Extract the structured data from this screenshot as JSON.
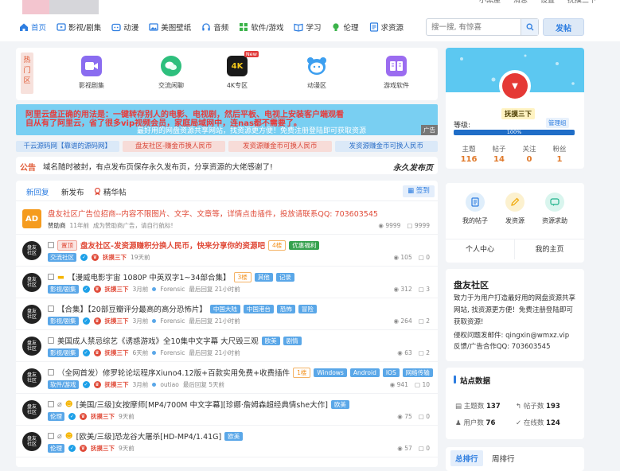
{
  "header": {
    "top_links": [
      "小黑屋",
      "消息",
      "设置",
      "抚摸三下"
    ],
    "nav": [
      {
        "label": "首页",
        "icon": "home-icon",
        "active": true
      },
      {
        "label": "影视/剧集",
        "icon": "video-icon"
      },
      {
        "label": "动漫",
        "icon": "anime-icon"
      },
      {
        "label": "美图壁纸",
        "icon": "image-icon"
      },
      {
        "label": "音频",
        "icon": "headphones-icon"
      },
      {
        "label": "软件/游戏",
        "icon": "apps-icon"
      },
      {
        "label": "学习",
        "icon": "book-icon"
      },
      {
        "label": "伦理",
        "icon": "bulb-icon"
      },
      {
        "label": "求资源",
        "icon": "request-icon"
      }
    ],
    "search_placeholder": "搜一搜, 有惊喜",
    "post_label": "发帖"
  },
  "quick": {
    "label": "热门区",
    "items": [
      {
        "label": "影视剧集",
        "icon": "video-cam-icon",
        "color": "#8a6cf0"
      },
      {
        "label": "交流闲聊",
        "icon": "chat-icon",
        "color": "#2ebf7d"
      },
      {
        "label": "4K专区",
        "icon": "4k-icon",
        "badge": "New"
      },
      {
        "label": "动漫区",
        "icon": "bear-icon",
        "color": "#3d9ff0"
      },
      {
        "label": "游戏软件",
        "icon": "book-app-icon",
        "color": "#9b6cf0"
      }
    ]
  },
  "banner": {
    "line1": "阿里云盘正确的用法是：一键转存别人的电影、电视剧，然后平板、电视上安装客户端观看",
    "line2": "自从有了阿里云，省了很多vip视频会员，家庭局域网中，连nas都不需要了。",
    "line3": "最好用的网盘资源共享网站，找资源更方便！免费注册登陆即可获取资源",
    "ad_label": "广告"
  },
  "links": [
    "千云源码网【靠谱的源码网】",
    "盘友社区-赚金币换人民币",
    "发资源赚金币可换人民币",
    "发资源赚金币可换人民币"
  ],
  "announce": {
    "label": "公告",
    "text": "域名随时被封，有点发布页保存永久发布页，分享资源的大佬感谢了!",
    "right": "永久发布页"
  },
  "thread_tabs": {
    "tabs": [
      "新回复",
      "新发布",
      "精华帖"
    ],
    "checkin": "签到"
  },
  "threads": [
    {
      "title": "盘友社区广告位招商--内容不限图片、文字、文章等，详情点击插件，投放请联系QQ: 703603545",
      "author": "赞助商",
      "time": "11年前",
      "extra": "成为赞助商广告，请自行航标!",
      "views": "9999",
      "replies": "9999",
      "avatar": "AD",
      "style": "ad"
    },
    {
      "title": "盘友社区-发资源赚积分换人民币，快来分享你的资源吧",
      "prefix": "置顶",
      "cat": "交流社区",
      "tags": [
        {
          "t": "4楼",
          "c": "orange"
        },
        {
          "t": "优惠福利",
          "c": "green"
        }
      ],
      "author": "抚摸三下",
      "time": "19天前",
      "views": "105",
      "replies": "0"
    },
    {
      "title": "【漫威电影宇宙 1080P 中英双字1~34部合集】",
      "cat": "影视/剧集",
      "tags": [
        {
          "t": "3楼",
          "c": "orange"
        },
        {
          "t": "其他",
          "c": "blue"
        },
        {
          "t": "记录",
          "c": "blue"
        }
      ],
      "author": "抚摸三下",
      "time": "3月前",
      "last": "Forensic",
      "last_time": "最后回复 21小时前",
      "views": "312",
      "replies": "3"
    },
    {
      "title": "【合集】【20部豆瓣评分最高的高分恐怖片】",
      "cat": "影视/剧集",
      "tags": [
        {
          "t": "中国大陆",
          "c": "blue"
        },
        {
          "t": "中国港台",
          "c": "blue"
        },
        {
          "t": "恐怖",
          "c": "blue"
        },
        {
          "t": "冒险",
          "c": "blue"
        }
      ],
      "author": "抚摸三下",
      "time": "3月前",
      "last": "Forensic",
      "last_time": "最后回复 21小时前",
      "views": "264",
      "replies": "2"
    },
    {
      "title": "美国成人禁忌综艺《诱惑游戏》全10集中文字幕 大尺毁三观",
      "cat": "影视/剧集",
      "tags": [
        {
          "t": "欧美",
          "c": "blue"
        },
        {
          "t": "剧情",
          "c": "blue"
        }
      ],
      "author": "抚摸三下",
      "time": "6天前",
      "last": "Forensic",
      "last_time": "最后回复 21小时前",
      "views": "63",
      "replies": "2"
    },
    {
      "title": "（全网首发）修罗轮论坛程序Xiuno4.12版+百款实用免费+收费插件",
      "cat": "软件/游戏",
      "tags": [
        {
          "t": "1楼",
          "c": "orange"
        },
        {
          "t": "Windows",
          "c": "blue"
        },
        {
          "t": "Android",
          "c": "blue"
        },
        {
          "t": "IOS",
          "c": "blue"
        },
        {
          "t": "网络传输",
          "c": "blue"
        }
      ],
      "author": "抚摸三下",
      "time": "3月前",
      "last": "outiao",
      "last_time": "最后回复 5天前",
      "views": "941",
      "replies": "10"
    },
    {
      "title": "[美国/三级]女按摩师[MP4/700M 中文字幕][珍娜·詹姆森超经典情she大作]",
      "cat": "伦理",
      "tags": [
        {
          "t": "欧美",
          "c": "blue"
        }
      ],
      "author": "抚摸三下",
      "time": "9天前",
      "views": "75",
      "replies": "0"
    },
    {
      "title": "[欧美/三级]恐龙谷大屠杀[HD-MP4/1.41G]",
      "cat": "伦理",
      "tags": [
        {
          "t": "欧美",
          "c": "blue"
        }
      ],
      "author": "抚摸三下",
      "time": "9天前",
      "views": "57",
      "replies": "0"
    }
  ],
  "profile": {
    "name": "抚摸三下",
    "admin_badge": "管理组",
    "level_label": "等级:",
    "progress_label": "100%",
    "progress": 1.0,
    "stats": [
      {
        "label": "主题",
        "value": "116"
      },
      {
        "label": "帖子",
        "value": "14"
      },
      {
        "label": "关注",
        "value": "0"
      },
      {
        "label": "粉丝",
        "value": "1"
      }
    ]
  },
  "actions": {
    "items": [
      {
        "label": "我的帖子",
        "icon": "posts-icon"
      },
      {
        "label": "发资源",
        "icon": "edit-icon"
      },
      {
        "label": "资源求助",
        "icon": "help-icon"
      }
    ],
    "user_center": "个人中心",
    "my_home": "我的主页"
  },
  "about": {
    "title": "盘友社区",
    "desc": "致力于为用户打造最好用的网盘资源共享网站, 找资源更方便！免费注册登陆即可获取资源!",
    "contact1": "侵权问题发邮件: qingxin@wmxz.vip",
    "contact2": "反馈/广告合作QQ: 703603545"
  },
  "site_stats": {
    "title": "站点数据",
    "items": [
      {
        "label": "主题数",
        "value": "137"
      },
      {
        "label": "帖子数",
        "value": "193"
      },
      {
        "label": "用户数",
        "value": "76"
      },
      {
        "label": "在线数",
        "value": "124"
      }
    ]
  },
  "ranking": {
    "tabs": [
      "总排行",
      "周排行"
    ]
  }
}
